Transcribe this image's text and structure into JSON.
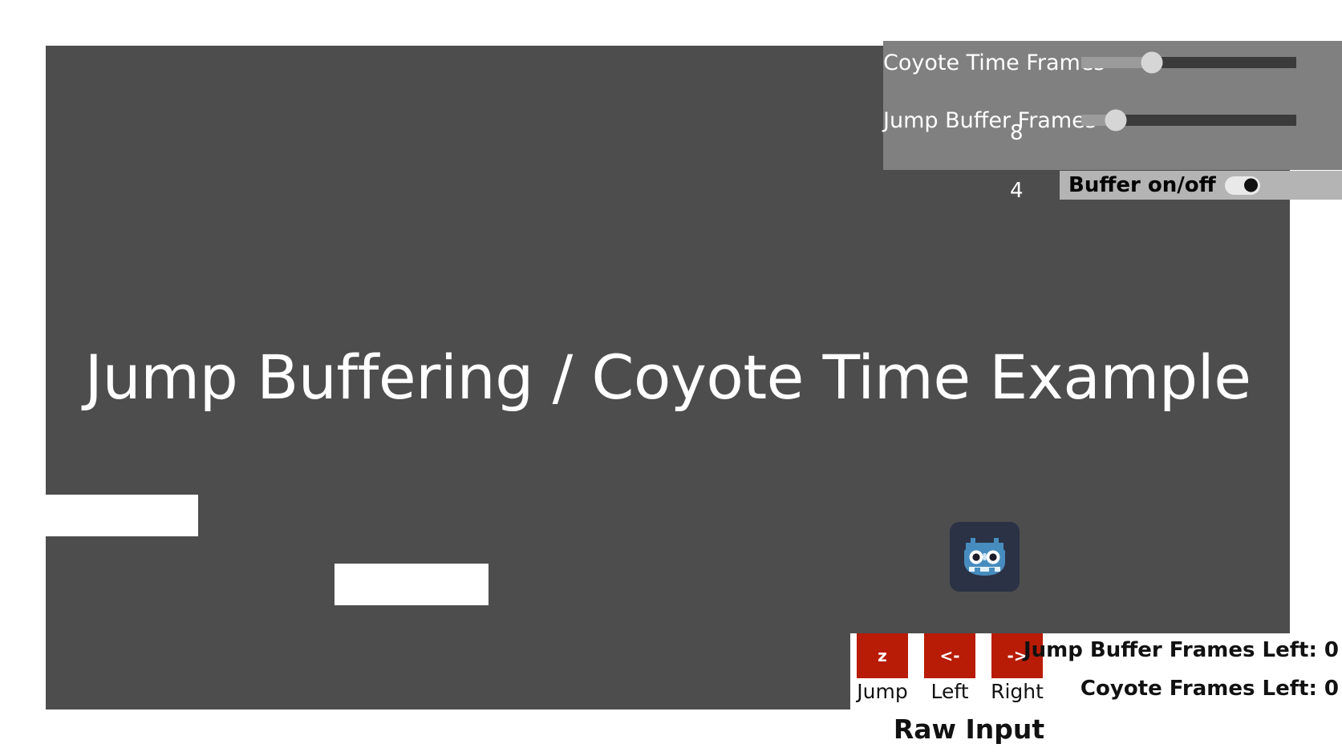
{
  "game": {
    "title": "Jump Buffering / Coyote Time Example",
    "background_color": "#4d4d4d",
    "platform_color": "#ffffff"
  },
  "settings_panel": {
    "background_color": "#808080",
    "sliders": [
      {
        "label": "Coyote Time Frames",
        "value": "8",
        "min": 0,
        "max": 60,
        "fill_percent": 33
      },
      {
        "label": "Jump Buffer Frames",
        "value": "4",
        "min": 0,
        "max": 60,
        "fill_percent": 16
      }
    ]
  },
  "buffer_toggle": {
    "label": "Buffer on/off",
    "state": "on",
    "strip_color": "#b4b4b4"
  },
  "player": {
    "sprite_name": "godot-robot-icon",
    "body_color": "#478cbf",
    "panel_color": "#2b3245"
  },
  "raw_input": {
    "caption": "Raw Input",
    "key_color": "#b81b06",
    "keys": [
      {
        "cap": "z",
        "name": "Jump"
      },
      {
        "cap": "<-",
        "name": "Left"
      },
      {
        "cap": "->",
        "name": "Right"
      }
    ],
    "counters": [
      {
        "text": "Jump Buffer Frames Left: 0"
      },
      {
        "text": "Coyote Frames Left: 0"
      }
    ]
  }
}
